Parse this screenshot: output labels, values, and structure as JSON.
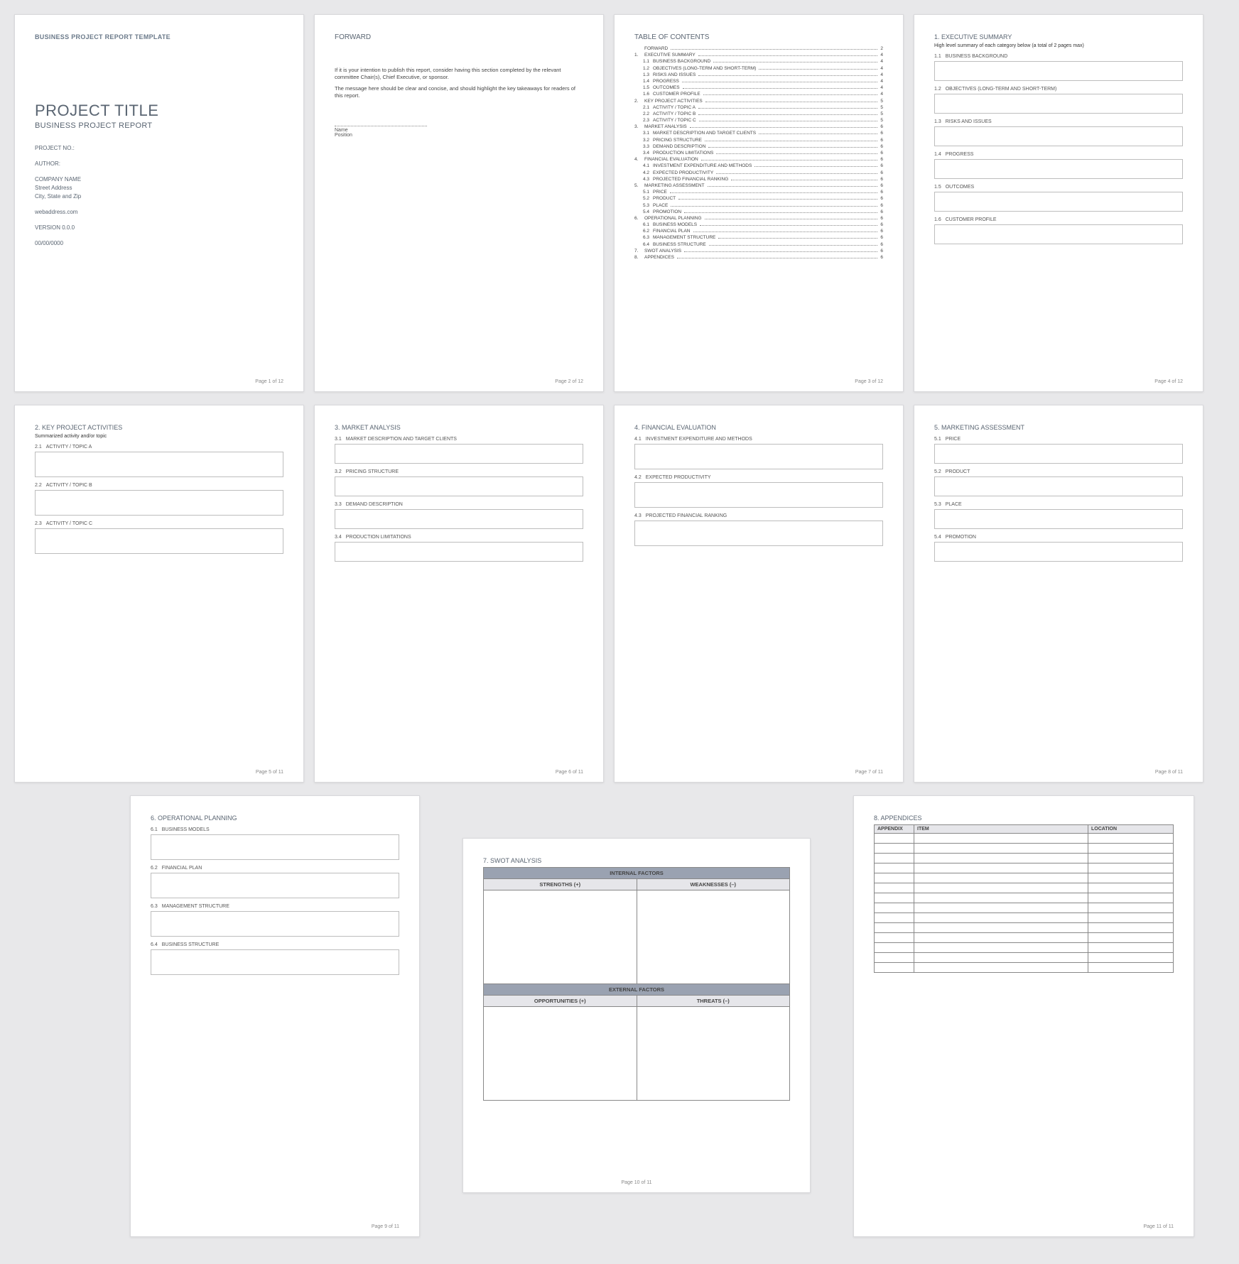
{
  "doc": {
    "template_header": "BUSINESS PROJECT REPORT TEMPLATE",
    "title": "PROJECT TITLE",
    "subtitle": "BUSINESS PROJECT REPORT",
    "project_no_label": "PROJECT NO.:",
    "author_label": "AUTHOR:",
    "company": "COMPANY NAME",
    "street": "Street Address",
    "citystate": "City, State and Zip",
    "web": "webaddress.com",
    "version": "VERSION 0.0.0",
    "date": "00/00/0000"
  },
  "forward": {
    "heading": "FORWARD",
    "p1": "If it is your intention to publish this report, consider having this section completed by the relevant committee Chair(s), Chief Executive, or sponsor.",
    "p2": "The message here should be clear and concise, and should highlight the key takeaways for readers of this report.",
    "name": "Name",
    "position": "Position"
  },
  "toc": {
    "heading": "TABLE OF CONTENTS",
    "items": [
      {
        "lvl": 0,
        "num": "",
        "txt": "FORWARD",
        "pg": "2"
      },
      {
        "lvl": 0,
        "num": "1.",
        "txt": "EXECUTIVE SUMMARY",
        "pg": "4"
      },
      {
        "lvl": 1,
        "num": "1.1",
        "txt": "BUSINESS BACKGROUND",
        "pg": "4"
      },
      {
        "lvl": 1,
        "num": "1.2",
        "txt": "OBJECTIVES (LONG-TERM AND SHORT-TERM)",
        "pg": "4"
      },
      {
        "lvl": 1,
        "num": "1.3",
        "txt": "RISKS AND ISSUES",
        "pg": "4"
      },
      {
        "lvl": 1,
        "num": "1.4",
        "txt": "PROGRESS",
        "pg": "4"
      },
      {
        "lvl": 1,
        "num": "1.5",
        "txt": "OUTCOMES",
        "pg": "4"
      },
      {
        "lvl": 1,
        "num": "1.6",
        "txt": "CUSTOMER PROFILE",
        "pg": "4"
      },
      {
        "lvl": 0,
        "num": "2.",
        "txt": "KEY PROJECT ACTIVITIES",
        "pg": "5"
      },
      {
        "lvl": 1,
        "num": "2.1",
        "txt": "ACTIVITY / TOPIC A",
        "pg": "5"
      },
      {
        "lvl": 1,
        "num": "2.2",
        "txt": "ACTIVITY / TOPIC B",
        "pg": "5"
      },
      {
        "lvl": 1,
        "num": "2.3",
        "txt": "ACTIVITY / TOPIC C",
        "pg": "5"
      },
      {
        "lvl": 0,
        "num": "3.",
        "txt": "MARKET ANALYSIS",
        "pg": "6"
      },
      {
        "lvl": 1,
        "num": "3.1",
        "txt": "MARKET DESCRIPTION AND TARGET CLIENTS",
        "pg": "6"
      },
      {
        "lvl": 1,
        "num": "3.2",
        "txt": "PRICING STRUCTURE",
        "pg": "6"
      },
      {
        "lvl": 1,
        "num": "3.3",
        "txt": "DEMAND DESCRIPTION",
        "pg": "6"
      },
      {
        "lvl": 1,
        "num": "3.4",
        "txt": "PRODUCTION LIMITATIONS",
        "pg": "6"
      },
      {
        "lvl": 0,
        "num": "4.",
        "txt": "FINANCIAL EVALUATION",
        "pg": "6"
      },
      {
        "lvl": 1,
        "num": "4.1",
        "txt": "INVESTMENT EXPENDITURE AND METHODS",
        "pg": "6"
      },
      {
        "lvl": 1,
        "num": "4.2",
        "txt": "EXPECTED PRODUCTIVITY",
        "pg": "6"
      },
      {
        "lvl": 1,
        "num": "4.3",
        "txt": "PROJECTED FINANCIAL RANKING",
        "pg": "6"
      },
      {
        "lvl": 0,
        "num": "5.",
        "txt": "MARKETING ASSESSMENT",
        "pg": "6"
      },
      {
        "lvl": 1,
        "num": "5.1",
        "txt": "PRICE",
        "pg": "6"
      },
      {
        "lvl": 1,
        "num": "5.2",
        "txt": "PRODUCT",
        "pg": "6"
      },
      {
        "lvl": 1,
        "num": "5.3",
        "txt": "PLACE",
        "pg": "6"
      },
      {
        "lvl": 1,
        "num": "5.4",
        "txt": "PROMOTION",
        "pg": "6"
      },
      {
        "lvl": 0,
        "num": "6.",
        "txt": "OPERATIONAL PLANNING",
        "pg": "6"
      },
      {
        "lvl": 1,
        "num": "6.1",
        "txt": "BUSINESS MODELS",
        "pg": "6"
      },
      {
        "lvl": 1,
        "num": "6.2",
        "txt": "FINANCIAL PLAN",
        "pg": "6"
      },
      {
        "lvl": 1,
        "num": "6.3",
        "txt": "MANAGEMENT STRUCTURE",
        "pg": "6"
      },
      {
        "lvl": 1,
        "num": "6.4",
        "txt": "BUSINESS STRUCTURE",
        "pg": "6"
      },
      {
        "lvl": 0,
        "num": "7.",
        "txt": "SWOT ANALYSIS",
        "pg": "6"
      },
      {
        "lvl": 0,
        "num": "8.",
        "txt": "APPENDICES",
        "pg": "6"
      }
    ]
  },
  "sec1": {
    "title": "1. EXECUTIVE SUMMARY",
    "note": "High level summary of each category below (a total of 2 pages max)",
    "subs": [
      {
        "n": "1.1",
        "t": "BUSINESS BACKGROUND"
      },
      {
        "n": "1.2",
        "t": "OBJECTIVES (LONG-TERM AND SHORT-TERM)"
      },
      {
        "n": "1.3",
        "t": "RISKS AND ISSUES"
      },
      {
        "n": "1.4",
        "t": "PROGRESS"
      },
      {
        "n": "1.5",
        "t": "OUTCOMES"
      },
      {
        "n": "1.6",
        "t": "CUSTOMER PROFILE"
      }
    ]
  },
  "sec2": {
    "title": "2. KEY PROJECT ACTIVITIES",
    "note": "Summarized activity and/or topic",
    "subs": [
      {
        "n": "2.1",
        "t": "ACTIVITY / TOPIC A"
      },
      {
        "n": "2.2",
        "t": "ACTIVITY / TOPIC B"
      },
      {
        "n": "2.3",
        "t": "ACTIVITY / TOPIC C"
      }
    ]
  },
  "sec3": {
    "title": "3. MARKET ANALYSIS",
    "subs": [
      {
        "n": "3.1",
        "t": "MARKET DESCRIPTION AND TARGET CLIENTS"
      },
      {
        "n": "3.2",
        "t": "PRICING STRUCTURE"
      },
      {
        "n": "3.3",
        "t": "DEMAND DESCRIPTION"
      },
      {
        "n": "3.4",
        "t": "PRODUCTION LIMITATIONS"
      }
    ]
  },
  "sec4": {
    "title": "4. FINANCIAL EVALUATION",
    "subs": [
      {
        "n": "4.1",
        "t": "INVESTMENT EXPENDITURE AND METHODS"
      },
      {
        "n": "4.2",
        "t": "EXPECTED PRODUCTIVITY"
      },
      {
        "n": "4.3",
        "t": "PROJECTED FINANCIAL RANKING"
      }
    ]
  },
  "sec5": {
    "title": "5. MARKETING ASSESSMENT",
    "subs": [
      {
        "n": "5.1",
        "t": "PRICE"
      },
      {
        "n": "5.2",
        "t": "PRODUCT"
      },
      {
        "n": "5.3",
        "t": "PLACE"
      },
      {
        "n": "5.4",
        "t": "PROMOTION"
      }
    ]
  },
  "sec6": {
    "title": "6. OPERATIONAL PLANNING",
    "subs": [
      {
        "n": "6.1",
        "t": "BUSINESS MODELS"
      },
      {
        "n": "6.2",
        "t": "FINANCIAL PLAN"
      },
      {
        "n": "6.3",
        "t": "MANAGEMENT STRUCTURE"
      },
      {
        "n": "6.4",
        "t": "BUSINESS STRUCTURE"
      }
    ]
  },
  "sec7": {
    "title": "7. SWOT ANALYSIS",
    "internal": "INTERNAL FACTORS",
    "external": "EXTERNAL FACTORS",
    "strengths": "STRENGTHS (+)",
    "weaknesses": "WEAKNESSES (–)",
    "opportunities": "OPPORTUNITIES (+)",
    "threats": "THREATS (–)"
  },
  "sec8": {
    "title": "8. APPENDICES",
    "cols": [
      "APPENDIX",
      "ITEM",
      "LOCATION"
    ],
    "rows": 14
  },
  "footers": {
    "p1": "Page 1 of 12",
    "p2": "Page 2 of 12",
    "p3": "Page 3 of 12",
    "p4": "Page 4 of 12",
    "p5": "Page 5 of 11",
    "p6": "Page 6 of 11",
    "p7": "Page 7 of 11",
    "p8": "Page 8 of 11",
    "p9": "Page 9 of 11",
    "p10": "Page 10 of 11",
    "p11": "Page 11 of 11"
  }
}
